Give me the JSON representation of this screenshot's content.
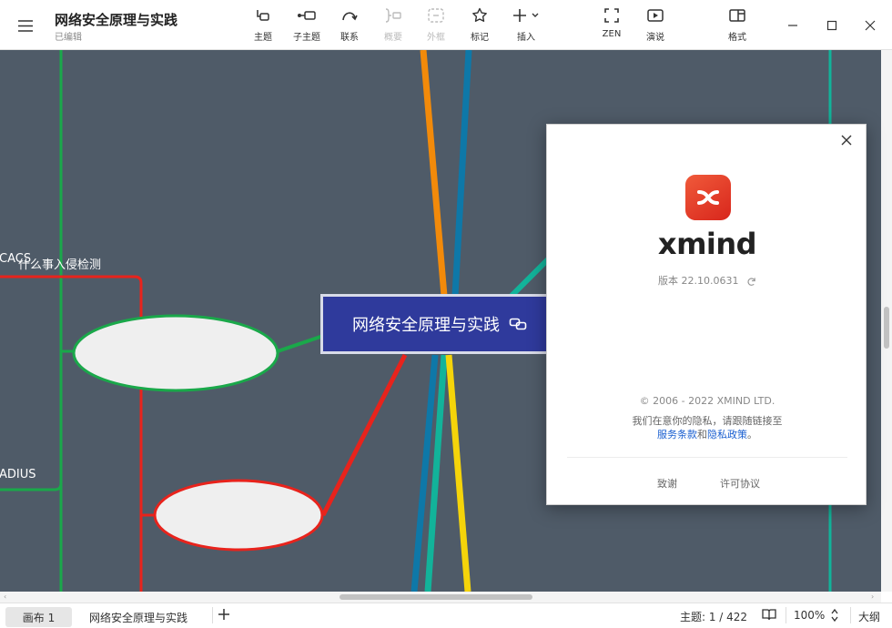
{
  "document": {
    "title": "网络安全原理与实践",
    "status": "已编辑"
  },
  "toolbar": {
    "items": [
      {
        "label": "主题",
        "icon": "topic-icon"
      },
      {
        "label": "子主题",
        "icon": "subtopic-icon"
      },
      {
        "label": "联系",
        "icon": "relationship-icon"
      },
      {
        "label": "概要",
        "icon": "summary-icon",
        "disabled": true
      },
      {
        "label": "外框",
        "icon": "boundary-icon",
        "disabled": true
      },
      {
        "label": "标记",
        "icon": "marker-icon"
      },
      {
        "label": "插入",
        "icon": "insert-icon"
      },
      {
        "label": "ZEN",
        "icon": "zen-icon"
      },
      {
        "label": "演说",
        "icon": "pitch-icon"
      },
      {
        "label": "格式",
        "icon": "format-panel-icon"
      }
    ]
  },
  "canvas": {
    "central_topic": "网络安全原理与实践",
    "branch_labels": {
      "intrusion": "什么事入侵检测",
      "tacacs": "CACS",
      "radius": "ADIUS"
    },
    "colors": {
      "background": "#4f5b68",
      "central": "#2f3a9c",
      "green": "#1aa84a",
      "red": "#e8231c",
      "orange": "#f28a0a",
      "teal": "#12b39a",
      "blue": "#0e78a8",
      "yellow": "#f5d40a"
    }
  },
  "about_dialog": {
    "app_name": "xmind",
    "version": "版本 22.10.0631",
    "copyright": "© 2006 - 2022 XMIND LTD.",
    "privacy_text": "我们在意你的隐私，请跟随链接至",
    "terms_link": "服务条款",
    "and_text": "和",
    "privacy_link": "隐私政策",
    "period": "。",
    "thanks_button": "致谢",
    "license_button": "许可协议"
  },
  "statusbar": {
    "sheets": [
      "画布 1",
      "网络安全原理与实践"
    ],
    "topic_count": "主题: 1 / 422",
    "zoom": "100%",
    "outline": "大纲"
  }
}
